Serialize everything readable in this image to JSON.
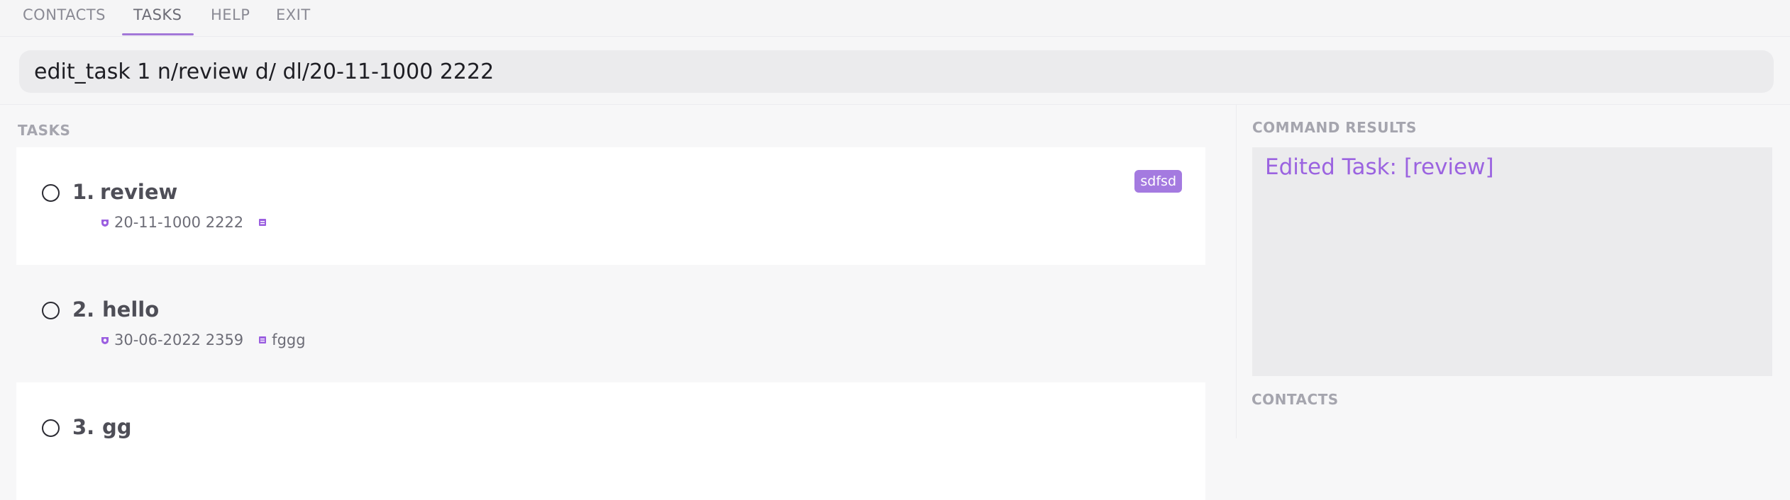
{
  "nav": {
    "items": [
      {
        "label": "CONTACTS",
        "active": false
      },
      {
        "label": "TASKS",
        "active": true
      },
      {
        "label": "HELP",
        "active": false
      },
      {
        "label": "EXIT",
        "active": false
      }
    ]
  },
  "command": {
    "value": "edit_task 1 n/review d/ dl/20-11-1000 2222"
  },
  "tasks_panel": {
    "label": "TASKS",
    "items": [
      {
        "number": "1.",
        "title": "review",
        "deadline": "20-11-1000 2222",
        "description": "",
        "tag": "sdfsd"
      },
      {
        "number": "2.",
        "title": "hello",
        "deadline": "30-06-2022 2359",
        "description": "fggg",
        "tag": ""
      },
      {
        "number": "3.",
        "title": "gg",
        "deadline": "",
        "description": "",
        "tag": ""
      }
    ]
  },
  "results_panel": {
    "label": "COMMAND RESULTS",
    "message": "Edited Task: [review]"
  },
  "contacts_panel": {
    "label": "CONTACTS"
  },
  "colors": {
    "accent": "#a277d8",
    "result_text": "#9b63e0",
    "tag_bg": "#a47ae0"
  }
}
